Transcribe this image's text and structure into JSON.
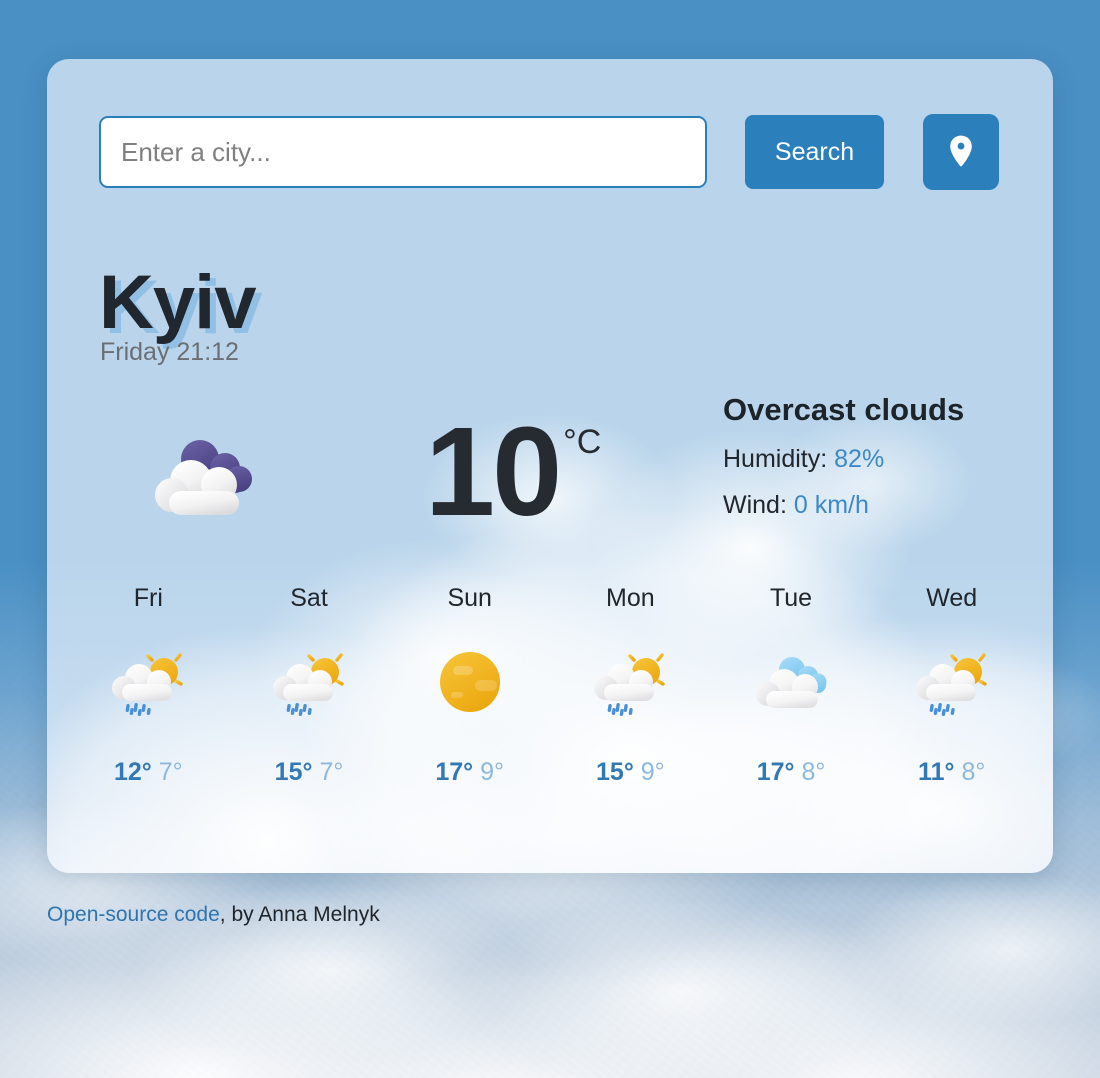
{
  "theme": {
    "sky_blue": "#4a90c4",
    "card_bg": "#e9f2fc",
    "accent_blue": "#2b80bc",
    "link_blue": "#2e74b0",
    "value_blue": "#3c89c8",
    "temp_max_blue": "#3178b4",
    "temp_min_blue": "#8cb8dd",
    "text_dark": "#20262c"
  },
  "search": {
    "placeholder": "Enter a city...",
    "value": "",
    "search_label": "Search",
    "location_icon": "map-pin-icon"
  },
  "current": {
    "city": "Kyiv",
    "datetime": "Friday 21:12",
    "icon": "overcast-clouds-icon",
    "temperature": "10",
    "unit": "°C",
    "description": "Overcast clouds",
    "humidity_label": "Humidity:",
    "humidity_value": "82%",
    "wind_label": "Wind:",
    "wind_value": "0 km/h"
  },
  "forecast": [
    {
      "day": "Fri",
      "icon": "sun-behind-rain-cloud-icon",
      "max": "12°",
      "min": "7°"
    },
    {
      "day": "Sat",
      "icon": "sun-behind-rain-cloud-icon",
      "max": "15°",
      "min": "7°"
    },
    {
      "day": "Sun",
      "icon": "clear-sun-icon",
      "max": "17°",
      "min": "9°"
    },
    {
      "day": "Mon",
      "icon": "sun-behind-rain-cloud-icon",
      "max": "15°",
      "min": "9°"
    },
    {
      "day": "Tue",
      "icon": "broken-clouds-icon",
      "max": "17°",
      "min": "8°"
    },
    {
      "day": "Wed",
      "icon": "sun-behind-rain-cloud-icon",
      "max": "11°",
      "min": "8°"
    }
  ],
  "footer": {
    "link_text": "Open-source code",
    "rest_text": ", by Anna Melnyk"
  }
}
